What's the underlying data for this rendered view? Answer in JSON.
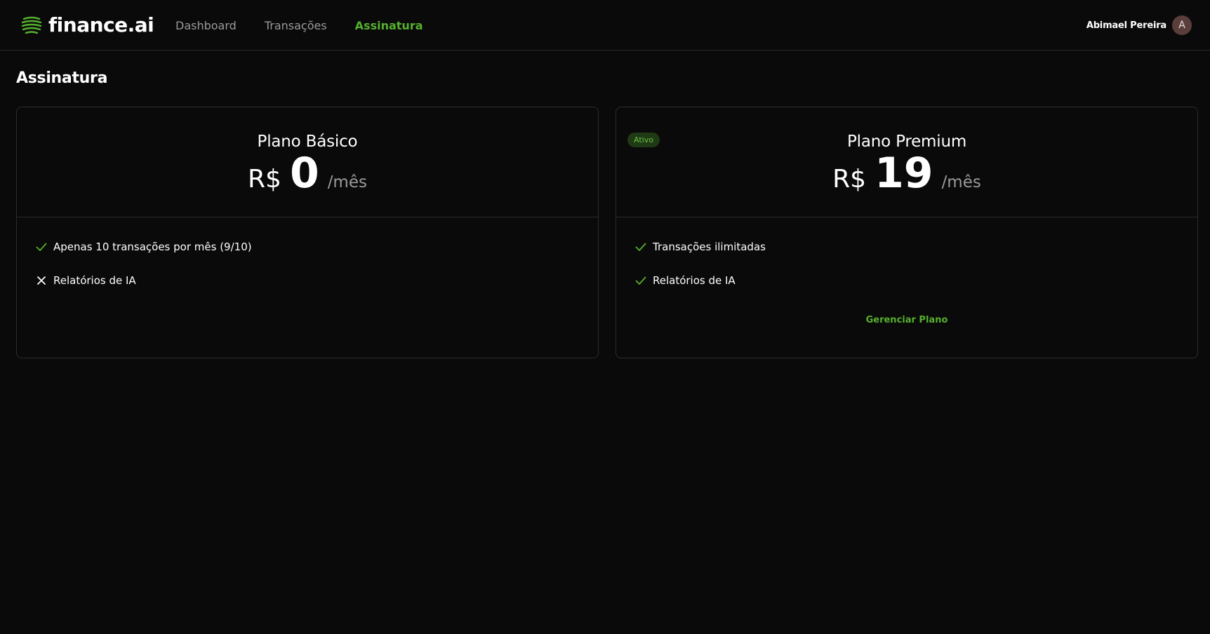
{
  "app": {
    "name": "finance.ai",
    "accent_color": "#55b02e",
    "logo_icon": "striped-sphere-icon"
  },
  "nav": {
    "items": [
      {
        "label": "Dashboard",
        "active": false
      },
      {
        "label": "Transações",
        "active": false
      },
      {
        "label": "Assinatura",
        "active": true
      }
    ]
  },
  "user": {
    "name": "Abimael Pereira",
    "initial": "A"
  },
  "page": {
    "title": "Assinatura"
  },
  "plans": [
    {
      "name": "Plano Básico",
      "currency": "R$",
      "amount": "0",
      "period": "/mês",
      "badge": null,
      "features": [
        {
          "text": "Apenas 10 transações por mês (9/10)",
          "icon": "check-icon"
        },
        {
          "text": "Relatórios de IA",
          "icon": "x-icon"
        }
      ]
    },
    {
      "name": "Plano Premium",
      "currency": "R$",
      "amount": "19",
      "period": "/mês",
      "badge": "Ativo",
      "features": [
        {
          "text": "Transações ilimitadas",
          "icon": "check-icon"
        },
        {
          "text": "Relatórios de IA",
          "icon": "check-icon"
        }
      ],
      "action_label": "Gerenciar Plano"
    }
  ]
}
